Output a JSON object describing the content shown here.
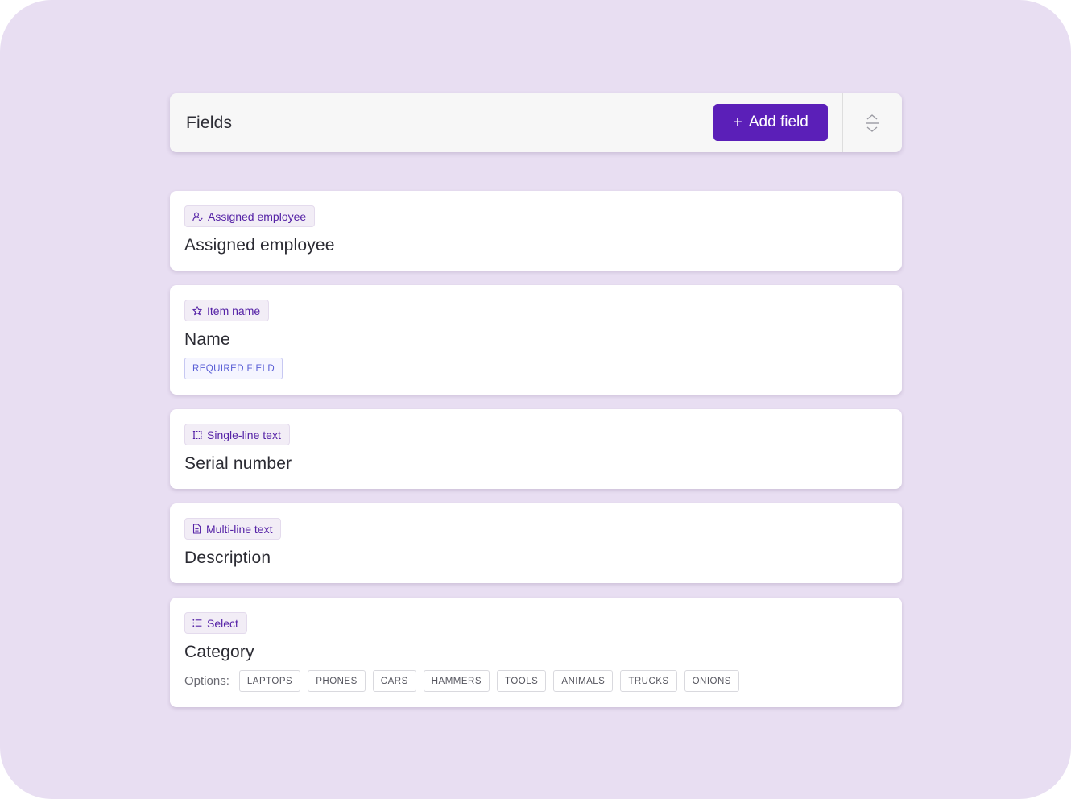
{
  "header": {
    "title": "Fields",
    "add_button_label": "Add field",
    "add_button_color": "#5b1fb8"
  },
  "fields": [
    {
      "type_label": "Assigned employee",
      "type_icon": "person-check-icon",
      "label": "Assigned employee"
    },
    {
      "type_label": "Item name",
      "type_icon": "star-icon",
      "label": "Name",
      "badge": "REQUIRED FIELD"
    },
    {
      "type_label": "Single-line text",
      "type_icon": "text-cursor-box-icon",
      "label": "Serial number"
    },
    {
      "type_label": "Multi-line text",
      "type_icon": "document-icon",
      "label": "Description"
    },
    {
      "type_label": "Select",
      "type_icon": "list-icon",
      "label": "Category",
      "options_label": "Options:",
      "options": [
        "LAPTOPS",
        "PHONES",
        "CARS",
        "HAMMERS",
        "TOOLS",
        "ANIMALS",
        "TRUCKS",
        "ONIONS"
      ]
    }
  ],
  "colors": {
    "background": "#e8def2",
    "accent": "#5b1fb8",
    "chip_text": "#5522a6",
    "required_badge": "#5a5fd6"
  }
}
